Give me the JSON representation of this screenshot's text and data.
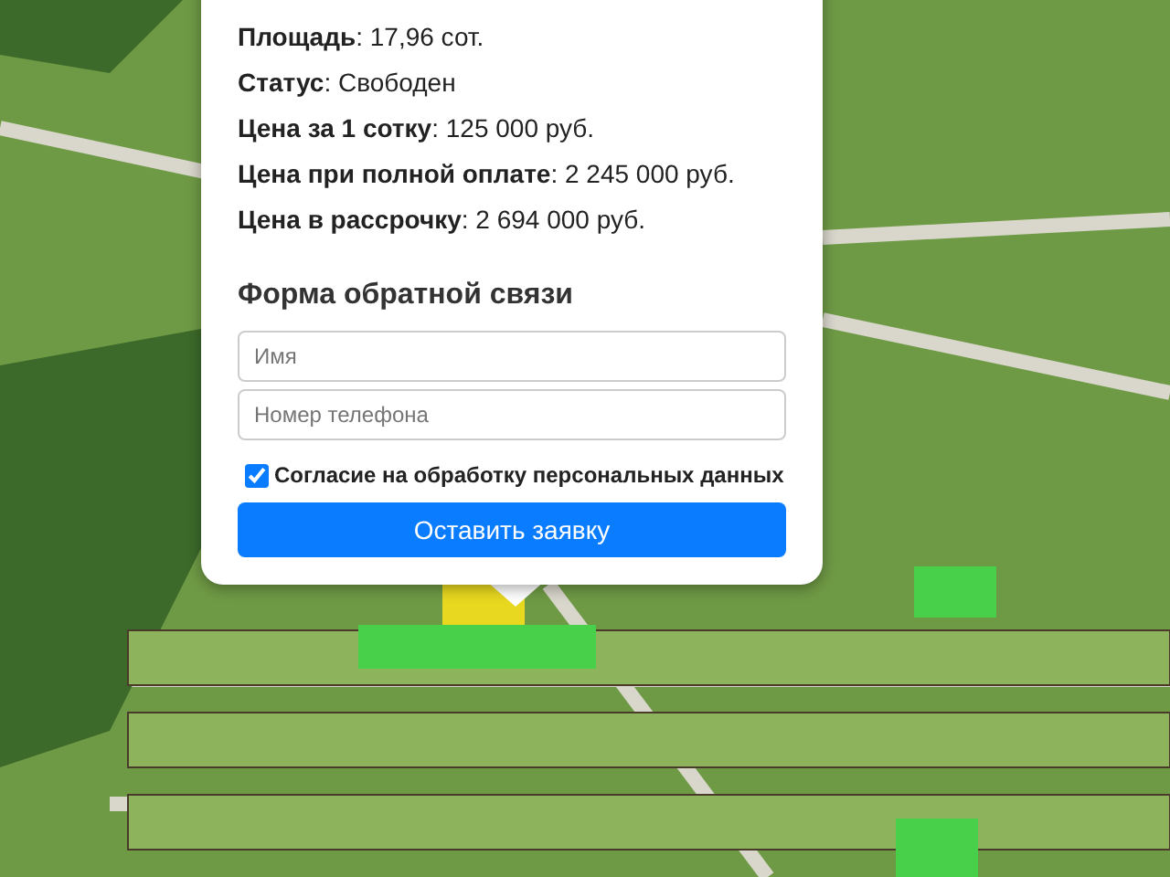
{
  "map": {
    "kind": "aerial"
  },
  "popup": {
    "details": [
      "**Площадь**: 17,96 сот.",
      "**Статус**: Свободен",
      "**Цена за 1 сотку**: 125 000 руб.",
      "**Цена при полной оплате**: 2 245 000 руб.",
      "**Цена в рассрочку**: 2 694 000 руб."
    ],
    "form": {
      "title": "Форма обратной связи",
      "fields": [
        {
          "placeholder": "Имя"
        },
        {
          "placeholder": "Номер телефона"
        }
      ],
      "consent": {
        "label": "Согласие на обработку персональных данных",
        "checked": true
      },
      "submit": "Оставить заявку"
    }
  }
}
